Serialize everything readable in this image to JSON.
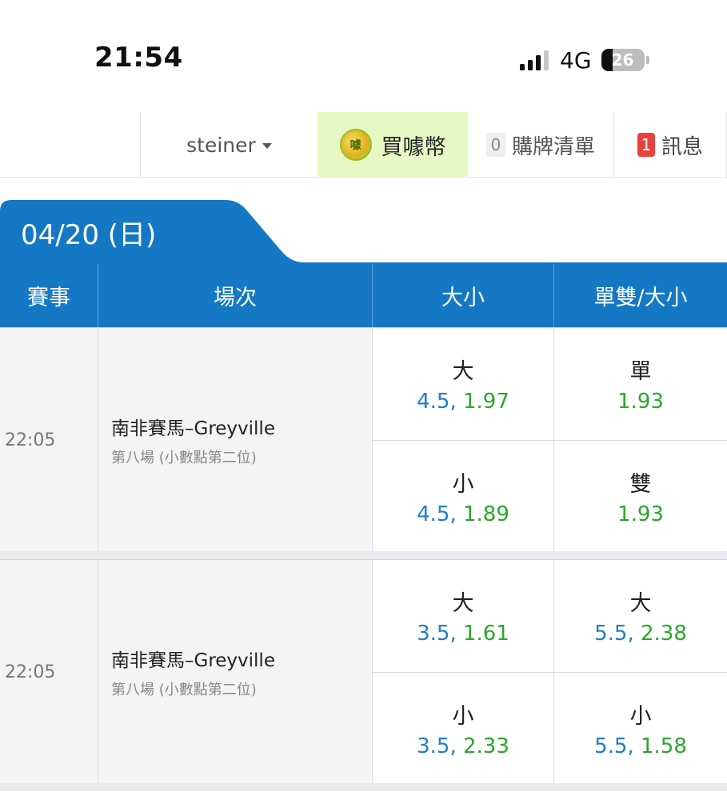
{
  "status_bar": {
    "time": "21:54",
    "network": "4G",
    "battery_level": "26",
    "battery_fraction": 0.26
  },
  "nav": {
    "username": "steiner",
    "buy_coins_label": "買噱幣",
    "coin_icon_text": "噱",
    "cart_count": "0",
    "cart_label": "購牌清單",
    "message_count": "1",
    "message_label": "訊息"
  },
  "date_tab": {
    "label": "04/20 (日)"
  },
  "table": {
    "headers": [
      "賽事",
      "場次",
      "大小",
      "單雙/大小"
    ],
    "matches": [
      {
        "time": "22:05",
        "race_name": "南非賽馬–Greyville",
        "race_sub": "第八場 (小數點第二位)",
        "col1": [
          {
            "label": "大",
            "line": "4.5,",
            "odds": "1.97"
          },
          {
            "label": "小",
            "line": "4.5,",
            "odds": "1.89"
          }
        ],
        "col2": [
          {
            "label": "單",
            "line": "",
            "odds": "1.93"
          },
          {
            "label": "雙",
            "line": "",
            "odds": "1.93"
          }
        ]
      },
      {
        "time": "22:05",
        "race_name": "南非賽馬–Greyville",
        "race_sub": "第八場 (小數點第二位)",
        "col1": [
          {
            "label": "大",
            "line": "3.5,",
            "odds": "1.61"
          },
          {
            "label": "小",
            "line": "3.5,",
            "odds": "2.33"
          }
        ],
        "col2": [
          {
            "label": "大",
            "line": "5.5,",
            "odds": "2.38"
          },
          {
            "label": "小",
            "line": "5.5,",
            "odds": "1.58"
          }
        ]
      }
    ]
  },
  "colors": {
    "primary_blue": "#1578c4",
    "line_blue": "#1a80c9",
    "odds_green": "#2aa72a",
    "buy_bg": "#e6f9c3",
    "badge_red": "#e8423c"
  }
}
